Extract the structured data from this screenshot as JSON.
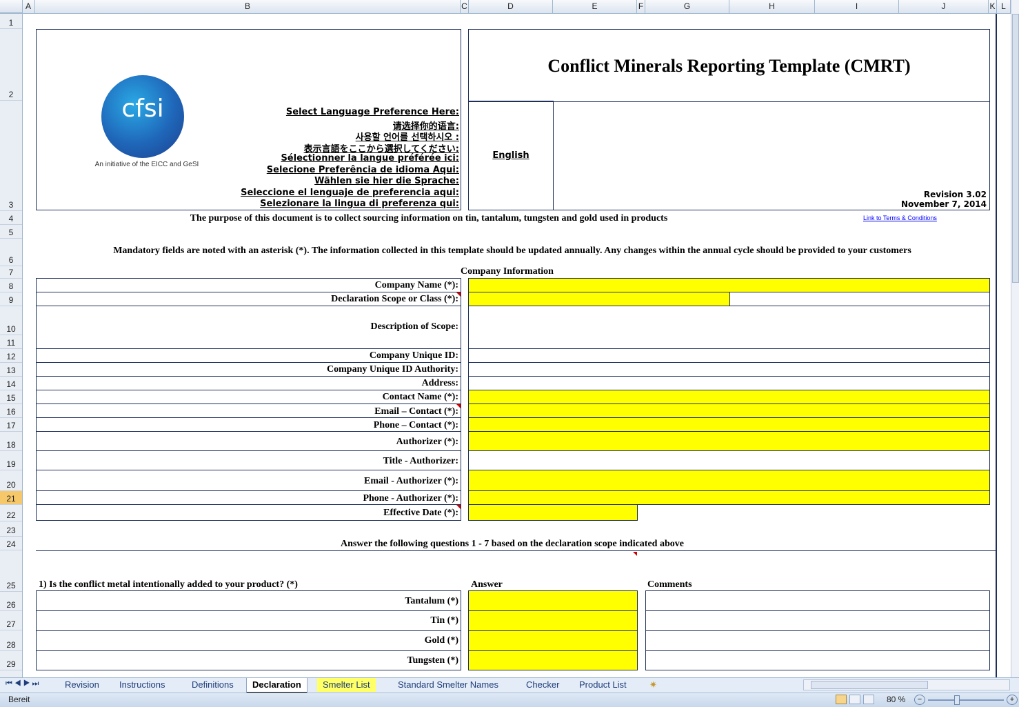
{
  "columns": [
    "A",
    "B",
    "C",
    "D",
    "E",
    "F",
    "G",
    "H",
    "I",
    "J",
    "K",
    "L"
  ],
  "rows": [
    "1",
    "2",
    "3",
    "4",
    "5",
    "6",
    "7",
    "8",
    "9",
    "10",
    "11",
    "12",
    "13",
    "14",
    "15",
    "16",
    "17",
    "18",
    "19",
    "20",
    "21",
    "22",
    "23",
    "24",
    "25",
    "26",
    "27",
    "28",
    "29"
  ],
  "header": {
    "title": "Conflict Minerals Reporting Template (CMRT)",
    "logo_text": "cfsi",
    "logo_caption": "An initiative of the EICC and GeSI",
    "language_prompts": [
      "Select Language Preference Here:",
      "请选择你的语言:",
      "사용할 언어를 선택하시오 :",
      "表示言語をここから選択してください:",
      "Sélectionner la langue préférée ici:",
      "Selecione Preferência de idioma Aqui:",
      "Wählen sie hier die Sprache:",
      "Seleccione el lenguaje de preferencia aqui:",
      "Selezionare la lingua di preferenza qui:"
    ],
    "selected_language": "English",
    "revision": "Revision 3.02",
    "revision_date": "November 7, 2014",
    "terms_link": "Link to Terms & Conditions"
  },
  "purpose_text": "The purpose of this document is to collect sourcing information on tin, tantalum, tungsten and gold used in products",
  "mandatory_text": "Mandatory fields are noted with an asterisk (*). The information collected in this template should be updated annually. Any changes within the annual cycle should be provided to your customers",
  "company_section_title": "Company Information",
  "company_fields": [
    "Company Name (*):",
    "Declaration Scope or Class (*):",
    "Description of Scope:",
    "Company Unique ID:",
    "Company Unique ID Authority:",
    "Address:",
    "Contact Name (*):",
    "Email – Contact (*):",
    "Phone – Contact (*):",
    "Authorizer (*):",
    "Title - Authorizer:",
    "Email - Authorizer (*):",
    "Phone - Authorizer (*):",
    "Effective Date (*):"
  ],
  "questions_intro": "Answer the following questions 1 - 7 based on the declaration scope indicated above",
  "question1": "1) Is the conflict metal intentionally added to your product? (*)",
  "answer_header": "Answer",
  "comments_header": "Comments",
  "metals": [
    "Tantalum  (*)",
    "Tin  (*)",
    "Gold  (*)",
    "Tungsten  (*)"
  ],
  "sheet_tabs": [
    "Revision",
    "Instructions",
    "Definitions",
    "Declaration",
    "Smelter List",
    "Standard Smelter Names",
    "Checker",
    "Product List"
  ],
  "active_tab": "Declaration",
  "status": {
    "ready": "Bereit",
    "zoom": "80 %"
  },
  "colors": {
    "required_field": "#ffff00",
    "border": "#1f2f5c",
    "link": "#0000ff",
    "smelter_tab": "#ffff66"
  }
}
